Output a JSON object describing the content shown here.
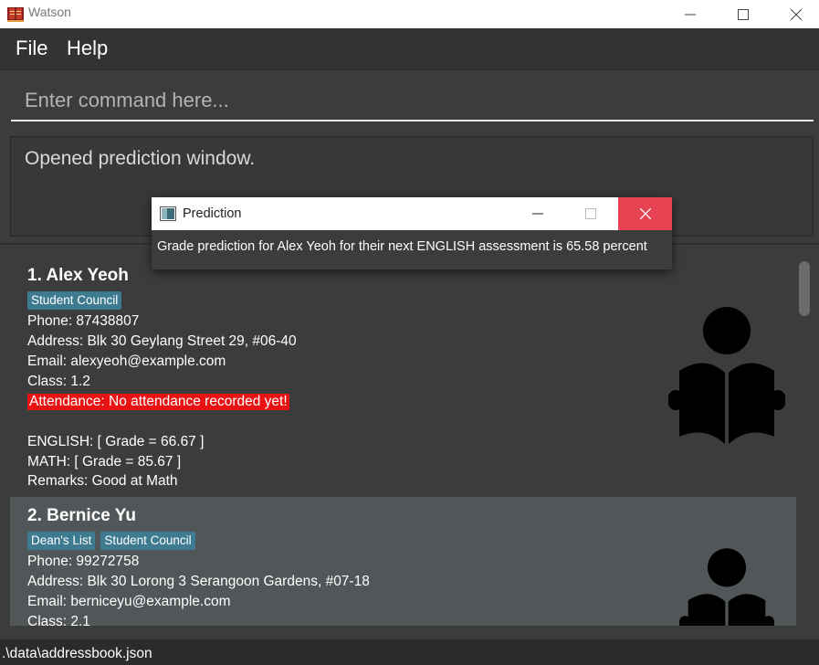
{
  "window": {
    "title": "Watson"
  },
  "menu": {
    "items": [
      "File",
      "Help"
    ]
  },
  "command": {
    "placeholder": "Enter command here..."
  },
  "result": {
    "text": "Opened prediction window."
  },
  "persons": [
    {
      "name": "1. Alex Yeoh",
      "tags": [
        "Student Council"
      ],
      "phone": "Phone: 87438807",
      "address": "Address: Blk 30 Geylang Street 29, #06-40",
      "email": "Email: alexyeoh@example.com",
      "class": "Class: 1.2",
      "attendance": "Attendance: No attendance recorded yet!",
      "grades": [
        "ENGLISH: [ Grade = 66.67 ]",
        "MATH: [ Grade = 85.67 ]"
      ],
      "remarks": "Remarks: Good at Math"
    },
    {
      "name": "2. Bernice Yu",
      "tags": [
        "Dean's List",
        "Student Council"
      ],
      "phone": "Phone: 99272758",
      "address": "Address: Blk 30 Lorong 3 Serangoon Gardens, #07-18",
      "email": "Email: berniceyu@example.com",
      "class": "Class: 2.1"
    }
  ],
  "status": {
    "path": ".\\data\\addressbook.json"
  },
  "popup": {
    "title": "Prediction",
    "message": "Grade prediction for Alex Yeoh for their next ENGLISH assessment is 65.58 percent"
  },
  "colors": {
    "background": "#3c3c3c",
    "tag": "#3e7b91",
    "attendance_alert": "#e81212",
    "close_button": "#e84352",
    "selected_card": "#515658"
  },
  "icons": {
    "app": "book-icon",
    "person": "reader-icon"
  }
}
